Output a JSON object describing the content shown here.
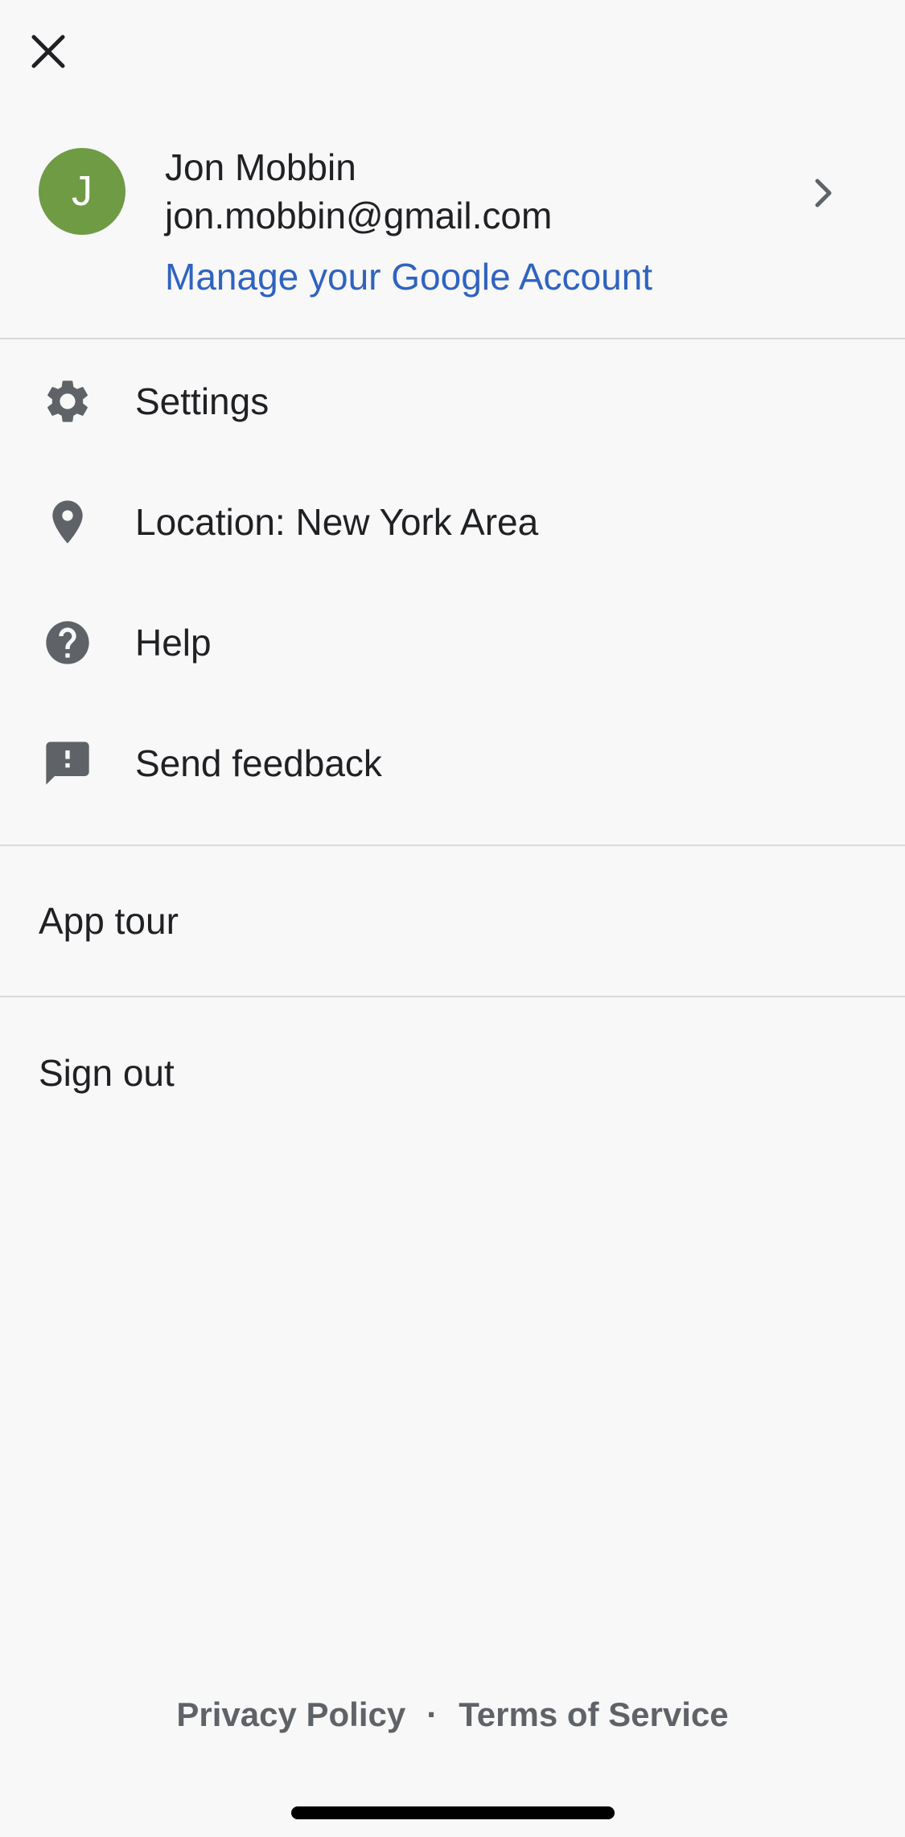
{
  "account": {
    "avatar_initial": "J",
    "name": "Jon Mobbin",
    "email": "jon.mobbin@gmail.com",
    "manage_label": "Manage your Google Account"
  },
  "menu": {
    "items": [
      {
        "label": "Settings",
        "icon": "gear-icon"
      },
      {
        "label": "Location: New York Area",
        "icon": "location-pin-icon"
      },
      {
        "label": "Help",
        "icon": "help-icon"
      },
      {
        "label": "Send feedback",
        "icon": "feedback-icon"
      }
    ]
  },
  "app_tour_label": "App tour",
  "sign_out_label": "Sign out",
  "footer": {
    "privacy_label": "Privacy Policy",
    "separator": "·",
    "terms_label": "Terms of Service"
  },
  "colors": {
    "background": "#f8f8f8",
    "avatar": "#6f9b45",
    "link": "#2f63c0",
    "icon": "#5f6368",
    "divider": "#dadada"
  }
}
